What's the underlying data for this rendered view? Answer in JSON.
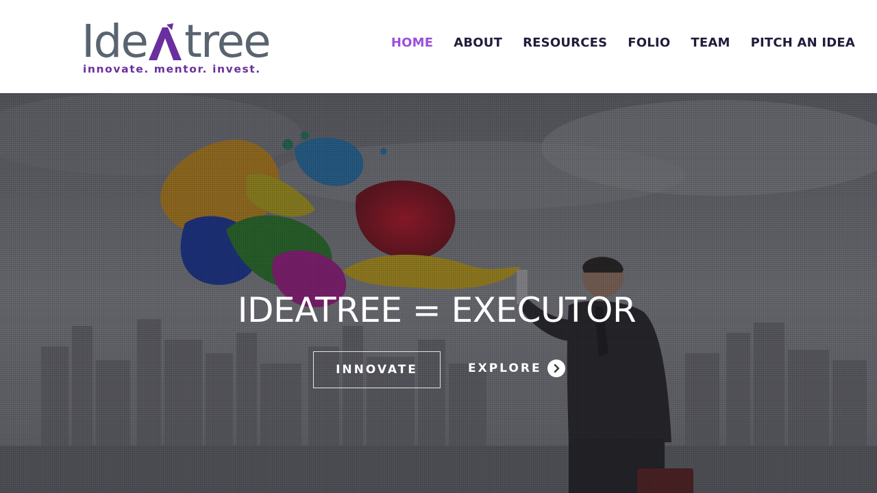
{
  "brand": {
    "name_parts": [
      "Ide",
      "A",
      "tree"
    ],
    "tagline": "innovate. mentor. invest.",
    "colors": {
      "grey": "#5a6470",
      "purple": "#6a2f9e"
    }
  },
  "nav": {
    "items": [
      {
        "label": "HOME",
        "active": true
      },
      {
        "label": "ABOUT",
        "active": false
      },
      {
        "label": "RESOURCES",
        "active": false
      },
      {
        "label": "FOLIO",
        "active": false
      },
      {
        "label": "TEAM",
        "active": false
      },
      {
        "label": "PITCH AN IDEA",
        "active": false
      }
    ],
    "active_color": "#9b4fdc",
    "text_color": "#1f1d3a"
  },
  "hero": {
    "title": "IDEATREE = EXECUTOR",
    "primary_button": "INNOVATE",
    "secondary_button": "EXPLORE",
    "secondary_icon": "chevron-right-circle-icon"
  }
}
